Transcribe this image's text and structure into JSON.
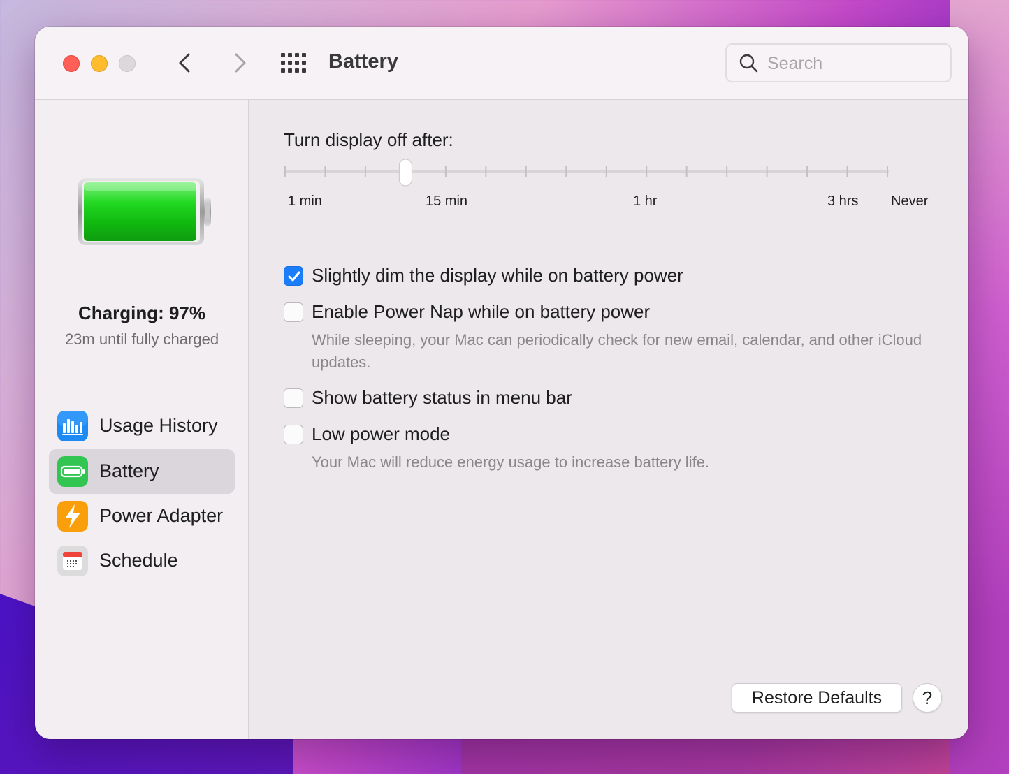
{
  "window": {
    "title": "Battery",
    "search_placeholder": "Search"
  },
  "sidebar": {
    "status_title": "Charging: 97%",
    "status_subtitle": "23m until fully charged",
    "charge_level": 0.97,
    "items": [
      {
        "label": "Usage History",
        "icon": "usage-history-icon",
        "selected": false
      },
      {
        "label": "Battery",
        "icon": "battery-icon",
        "selected": true
      },
      {
        "label": "Power Adapter",
        "icon": "power-adapter-icon",
        "selected": false
      },
      {
        "label": "Schedule",
        "icon": "schedule-icon",
        "selected": false
      }
    ]
  },
  "main": {
    "slider": {
      "label": "Turn display off after:",
      "tick_labels": [
        "1 min",
        "15 min",
        "1 hr",
        "3 hrs",
        "Never"
      ],
      "selected_tick_index": 3,
      "tick_count": 16
    },
    "options": [
      {
        "label": "Slightly dim the display while on battery power",
        "checked": true,
        "note": ""
      },
      {
        "label": "Enable Power Nap while on battery power",
        "checked": false,
        "note": "While sleeping, your Mac can periodically check for new email, calendar, and other iCloud updates."
      },
      {
        "label": "Show battery status in menu bar",
        "checked": false,
        "note": ""
      },
      {
        "label": "Low power mode",
        "checked": false,
        "note": "Your Mac will reduce energy usage to increase battery life."
      }
    ],
    "restore_label": "Restore Defaults",
    "help_label": "?"
  },
  "colors": {
    "accent": "#1a7dfa",
    "battery_green": "#16c816"
  }
}
